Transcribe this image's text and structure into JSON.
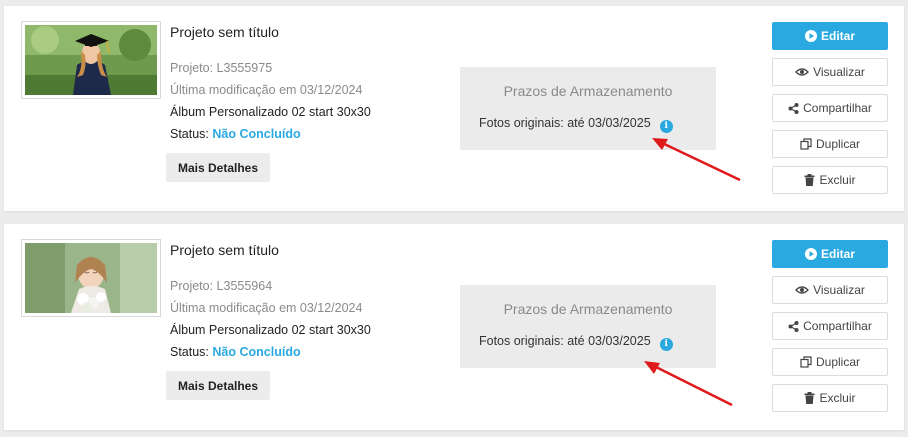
{
  "colors": {
    "accent": "#2aa9e0",
    "arrow": "#e0191b",
    "panel": "#ebebeb"
  },
  "projects": [
    {
      "thumbnail": "graduate-photo",
      "title": "Projeto sem título",
      "project_label": "Projeto: L3555975",
      "modified": "Última modificação em 03/12/2024",
      "product": "Álbum Personalizado 02 start 30x30",
      "status_label": "Status:",
      "status_value": "Não Concluído",
      "details_button": "Mais Detalhes",
      "storage_title": "Prazos de Armazenamento",
      "storage_line": "Fotos originais: até 03/03/2025",
      "actions": {
        "edit": "Editar",
        "view": "Visualizar",
        "share": "Compartilhar",
        "duplicate": "Duplicar",
        "delete": "Excluir"
      }
    },
    {
      "thumbnail": "bride-photo",
      "title": "Projeto sem título",
      "project_label": "Projeto: L3555964",
      "modified": "Última modificação em 03/12/2024",
      "product": "Álbum Personalizado 02 start 30x30",
      "status_label": "Status:",
      "status_value": "Não Concluído",
      "details_button": "Mais Detalhes",
      "storage_title": "Prazos de Armazenamento",
      "storage_line": "Fotos originais: até 03/03/2025",
      "actions": {
        "edit": "Editar",
        "view": "Visualizar",
        "share": "Compartilhar",
        "duplicate": "Duplicar",
        "delete": "Excluir"
      }
    }
  ]
}
